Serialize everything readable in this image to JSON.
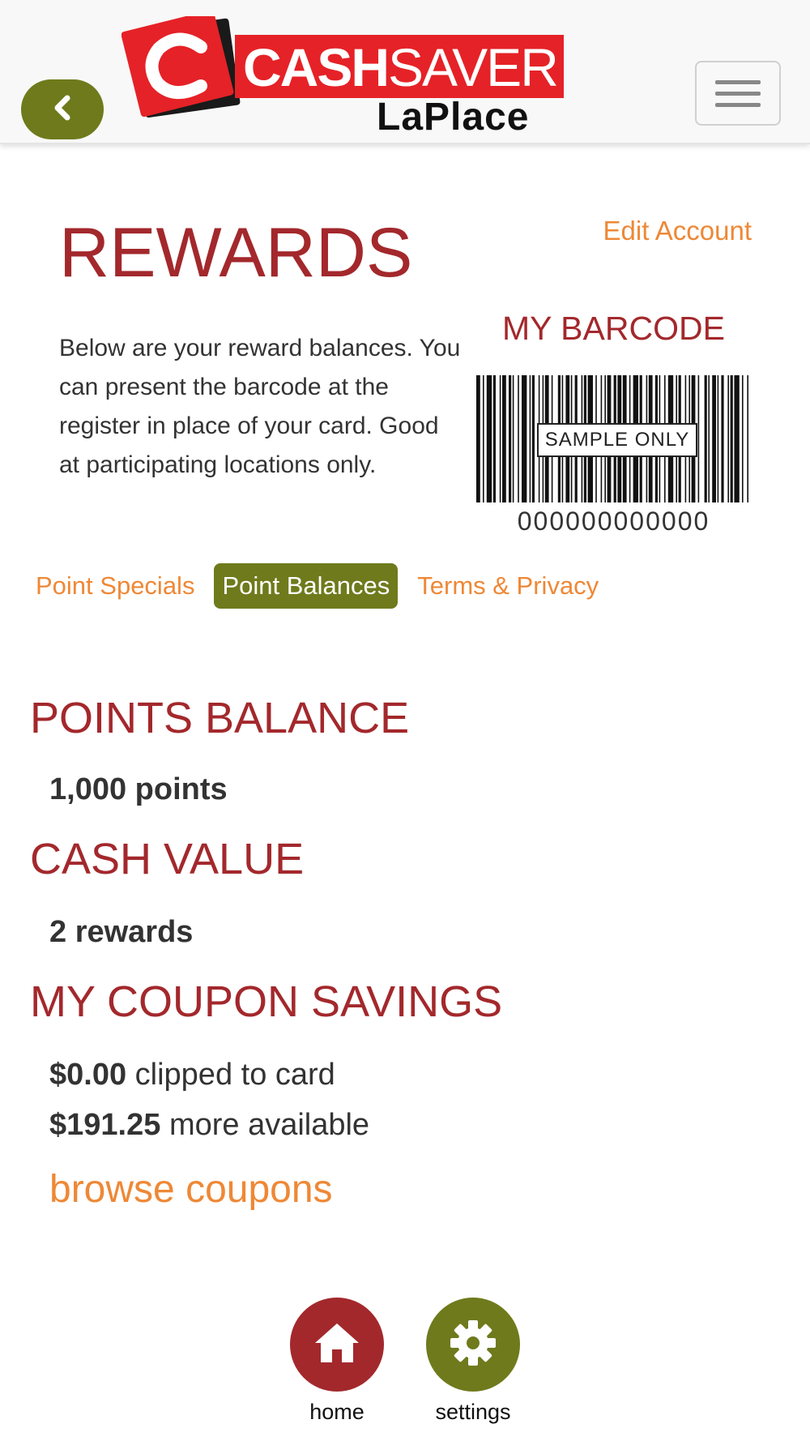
{
  "header": {
    "back_icon": "chevron-left-icon",
    "logo": {
      "word_bold": "CASH",
      "word_light": "SAVER",
      "location": "LaPlace",
      "colors": {
        "red": "#e52227",
        "dark": "#1a1a1a"
      }
    },
    "menu_icon": "hamburger-icon"
  },
  "page": {
    "title": "REWARDS",
    "edit_account": "Edit Account",
    "intro": "Below are your reward balances. You can present the barcode at the register in place of your card. Good at participating locations only."
  },
  "barcode": {
    "title": "MY BARCODE",
    "sample_label": "SAMPLE ONLY",
    "number": "000000000000"
  },
  "tabs": [
    {
      "label": "Point Specials",
      "active": false
    },
    {
      "label": "Point Balances",
      "active": true
    },
    {
      "label": "Terms & Privacy",
      "active": false
    }
  ],
  "balances": {
    "points_heading": "POINTS BALANCE",
    "points_value": "1,000 points",
    "cash_heading": "CASH VALUE",
    "cash_value": "2 rewards",
    "coupon_heading": "MY COUPON SAVINGS",
    "clipped_amount": "$0.00",
    "clipped_text": "clipped to card",
    "available_amount": "$191.25",
    "available_text": "more available",
    "browse_link": "browse coupons"
  },
  "footer": {
    "home_label": "home",
    "home_icon": "house-icon",
    "settings_label": "settings",
    "settings_icon": "gear-icon"
  },
  "colors": {
    "brand_red": "#a3282c",
    "brand_green": "#6f7a1c",
    "link_orange": "#ee8836"
  }
}
